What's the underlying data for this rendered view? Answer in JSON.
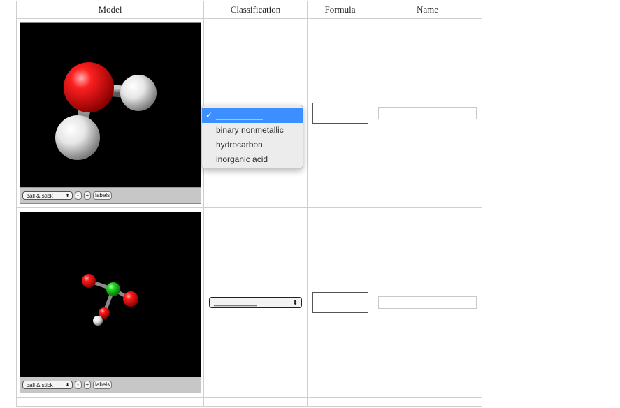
{
  "table": {
    "headers": [
      "Model",
      "Classification",
      "Formula",
      "Name"
    ]
  },
  "rows": [
    {
      "viewer": {
        "style_label": "ball & stick",
        "zoom_out_label": "-",
        "zoom_in_label": "+",
        "labels_label": "labels"
      },
      "classification": {
        "selected": "__________",
        "dropdown_open": true
      },
      "formula_value": "",
      "name_value": ""
    },
    {
      "viewer": {
        "style_label": "ball & stick",
        "zoom_out_label": "-",
        "zoom_in_label": "+",
        "labels_label": "labels"
      },
      "classification": {
        "selected": "__________",
        "dropdown_open": false
      },
      "formula_value": "",
      "name_value": ""
    }
  ],
  "dropdown": {
    "check": "✓",
    "options": [
      "__________",
      "binary nonmetallic",
      "hydrocarbon",
      "inorganic acid"
    ],
    "selected_index": 0
  },
  "icons": {
    "select_arrows": "⬍"
  },
  "colors": {
    "oxygen": "#ff1010",
    "hydrogen": "#f2f2f2",
    "chlorine": "#22dd22",
    "bond": "#8a8a8a",
    "viewer_bg": "#000000",
    "selection": "#3d8eff"
  }
}
